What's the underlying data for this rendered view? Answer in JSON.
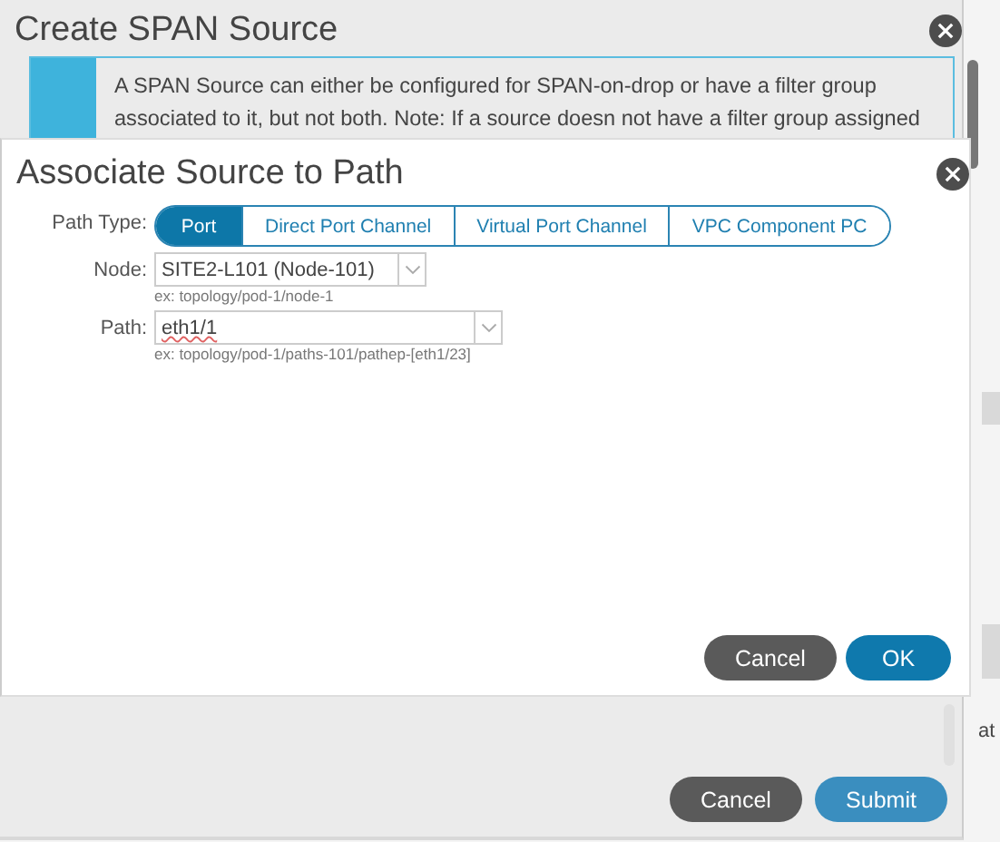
{
  "background": {
    "fragment": "at"
  },
  "outer_dialog": {
    "title": "Create SPAN Source",
    "info": "A SPAN Source can either be configured for SPAN-on-drop or have a filter group associated to it, but not both. Note: If a source doesn not have a filter group assigned",
    "buttons": [
      {
        "label": "Cancel",
        "kind": "secondary"
      },
      {
        "label": "Submit",
        "kind": "primary"
      }
    ]
  },
  "dialog": {
    "title": "Associate Source to Path",
    "path_type": {
      "label": "Path Type:",
      "tabs": [
        {
          "label": "Port",
          "selected": true
        },
        {
          "label": "Direct Port Channel",
          "selected": false
        },
        {
          "label": "Virtual Port Channel",
          "selected": false
        },
        {
          "label": "VPC Component PC",
          "selected": false
        }
      ]
    },
    "fields": [
      {
        "label": "Node:",
        "value": "SITE2-L101 (Node-101)",
        "hint": "ex: topology/pod-1/node-1",
        "kind": "short"
      },
      {
        "label": "Path:",
        "value": "eth1/1",
        "hint": "ex: topology/pod-1/paths-101/pathep-[eth1/23]",
        "kind": "long"
      }
    ],
    "buttons": [
      {
        "label": "Cancel",
        "kind": "secondary"
      },
      {
        "label": "OK",
        "kind": "primary"
      }
    ]
  }
}
